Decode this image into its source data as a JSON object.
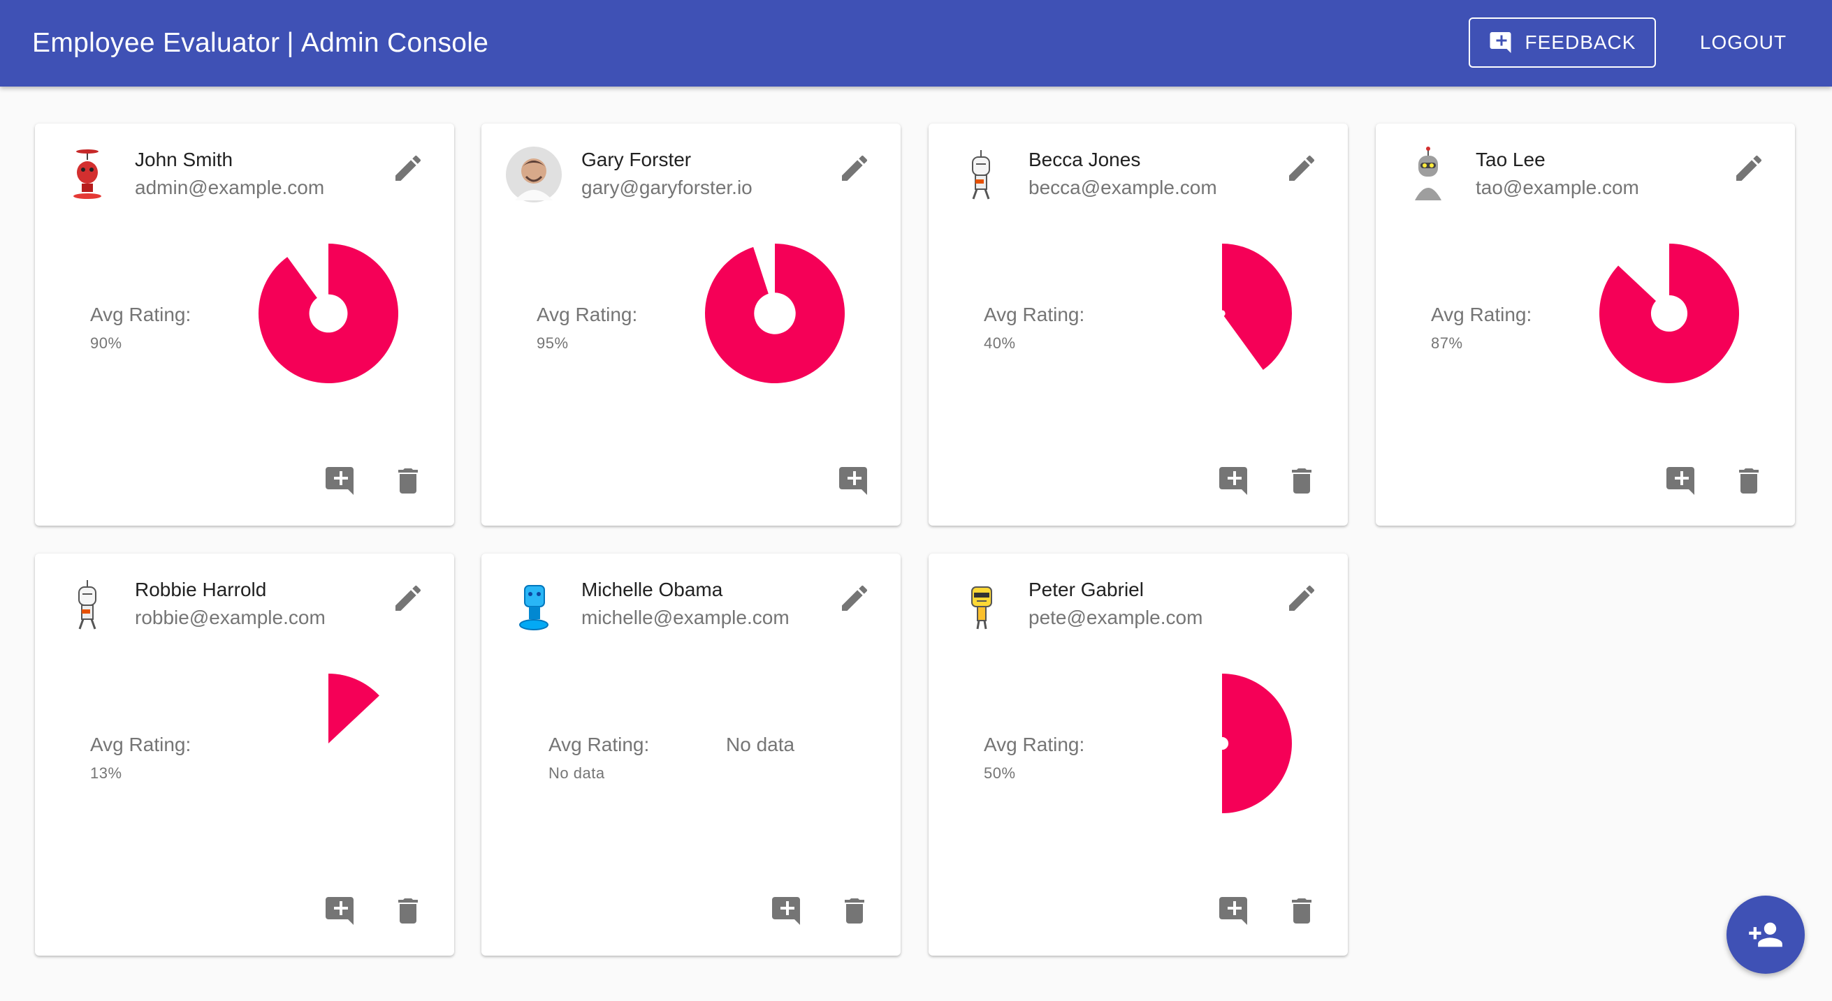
{
  "app": {
    "title": "Employee Evaluator",
    "separator": "|",
    "subtitle": "Admin Console",
    "feedback_label": "FEEDBACK",
    "logout_label": "LOGOUT"
  },
  "colors": {
    "primary": "#3f51b5",
    "chart": "#f50057",
    "icon": "#757575"
  },
  "employees": [
    {
      "name": "John Smith",
      "email": "admin@example.com",
      "avg_label": "Avg Rating:",
      "avg_value": "90%",
      "rating": 0.9,
      "avatar": "red-robot-avatar",
      "has_delete": true,
      "chart_text": ""
    },
    {
      "name": "Gary Forster",
      "email": "gary@garyforster.io",
      "avg_label": "Avg Rating:",
      "avg_value": "95%",
      "rating": 0.95,
      "avatar": "photo-avatar",
      "has_delete": false,
      "chart_text": ""
    },
    {
      "name": "Becca Jones",
      "email": "becca@example.com",
      "avg_label": "Avg Rating:",
      "avg_value": "40%",
      "rating": 0.4,
      "avatar": "white-robot-avatar",
      "has_delete": true,
      "chart_text": ""
    },
    {
      "name": "Tao Lee",
      "email": "tao@example.com",
      "avg_label": "Avg Rating:",
      "avg_value": "87%",
      "rating": 0.87,
      "avatar": "grey-robot-avatar",
      "has_delete": true,
      "chart_text": ""
    },
    {
      "name": "Robbie Harrold",
      "email": "robbie@example.com",
      "avg_label": "Avg Rating:",
      "avg_value": "13%",
      "rating": 0.13,
      "avatar": "white-robot-avatar",
      "has_delete": true,
      "chart_text": ""
    },
    {
      "name": "Michelle Obama",
      "email": "michelle@example.com",
      "avg_label": "Avg Rating:",
      "avg_value": "No data",
      "rating": null,
      "avatar": "blue-robot-avatar",
      "has_delete": true,
      "chart_text": "No data"
    },
    {
      "name": "Peter Gabriel",
      "email": "pete@example.com",
      "avg_label": "Avg Rating:",
      "avg_value": "50%",
      "rating": 0.5,
      "avatar": "yellow-robot-avatar",
      "has_delete": true,
      "chart_text": ""
    }
  ],
  "fab_icon": "add-person-icon"
}
